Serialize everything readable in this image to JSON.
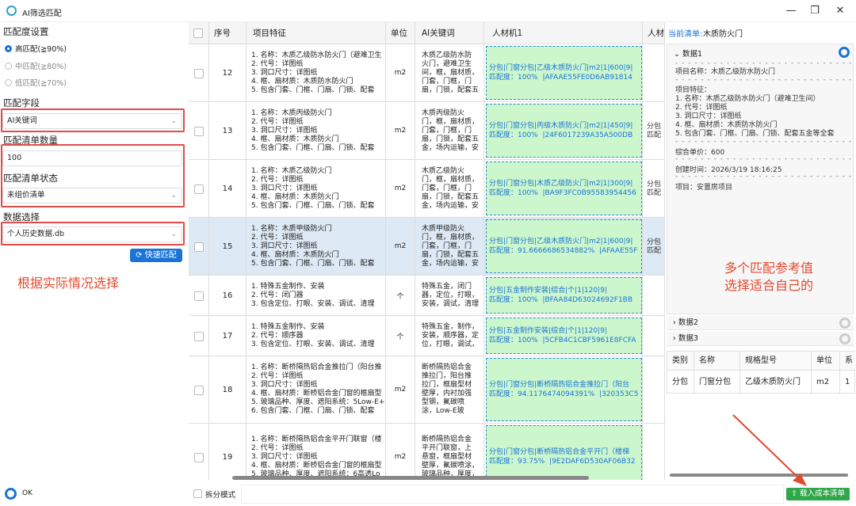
{
  "window": {
    "title": "AI筛选匹配",
    "min": "—",
    "max": "❐",
    "close": "✕"
  },
  "left": {
    "match_settings_label": "匹配度设置",
    "radios": [
      {
        "label": "高匹配(≧90%)",
        "selected": true
      },
      {
        "label": "中匹配(≧80%)",
        "selected": false
      },
      {
        "label": "低匹配(≧70%)",
        "selected": false
      }
    ],
    "match_field_label": "匹配字段",
    "match_field_value": "AI关键词",
    "list_count_label": "匹配清单数量",
    "list_count_value": "100",
    "list_status_label": "匹配清单状态",
    "list_status_value": "未组价清单",
    "data_select_label": "数据选择",
    "data_select_value": "个人历史数据.db",
    "quick_match_button": "快速匹配",
    "hint": "根据实际情况选择",
    "status_text": "OK"
  },
  "grid": {
    "headers": [
      "序号",
      "项目特征",
      "单位",
      "AI关键词",
      "人材机1",
      "人材"
    ],
    "rows": [
      {
        "no": "12",
        "spec": "1. 名称：木质乙级防水防火门（避难卫生\n2. 代号：详图纸\n3. 洞口尺寸：详图纸\n4. 框、扇材质：木质防水防火门\n5. 包含门套、门框、门扇、门锁、配套",
        "unit": "m2",
        "kw": "木质乙级防水防\n火门，避难卫生\n间，框，扇材质，\n门套，门框，门\n扇，门锁，配套五",
        "match": "分包|门窗分包|乙级木质防火门|m2|1|600|9|\n匹配度：100%  |AFAAE55FE0D6AB91814",
        "extra": ""
      },
      {
        "no": "13",
        "spec": "1. 名称：木质丙级防火门\n2. 代号：详图纸\n3. 洞口尺寸：详图纸\n4. 框、扇材质：木质防火门\n5. 包含门套、门框、门扇、门锁、配套",
        "unit": "m2",
        "kw": "木质丙级防火\n门，框，扇材质，\n门套，门框，门\n扇，门锁，配套五\n金，场内运输，安",
        "match": "分包|门窗分包|丙级木质防火门|m2|1|450|9|\n匹配度：100%  |24F6017239A35A500DB",
        "extra": "分包\n匹配"
      },
      {
        "no": "14",
        "spec": "1. 名称：木质乙级防火门\n2. 代号：详图纸\n3. 洞口尺寸：详图纸\n4. 框、扇材质：木质防火门\n5. 包含门套、门框、门扇、门锁、配套",
        "unit": "m2",
        "kw": "木质乙级防火\n门，框，扇材质，\n门套，门框，门\n扇，门锁，配套五\n金，场内运输，安",
        "match": "分包|门窗分包|木质乙级防火门|m2|1|300|9|\n匹配度：100%  |BA9F3FC0B95583954456",
        "extra": "分包\n匹配"
      },
      {
        "no": "15",
        "spec": "1. 名称：木质甲级防火门\n2. 代号：详图纸\n3. 洞口尺寸：详图纸\n4. 框、扇材质：木质防火门\n5. 包含门套、门框、门扇、门锁、配套",
        "unit": "m2",
        "kw": "木质甲级防火\n门，框，扇材质，\n门套，门框，门\n扇，门锁，配套五\n金，场内运输，安",
        "match": "分包|门窗分包|乙级木质防火门|m2|1|600|9|\n匹配度：91.6666686534882%  |AFAAE55F",
        "extra": "分包\n匹配"
      },
      {
        "no": "16",
        "spec": "1. 特殊五金制作、安装\n2. 代号：闭门器\n3. 包含定位、打眼、安装、调试、清理",
        "unit": "个",
        "kw": "特殊五金，闭门\n器，定位，打眼，\n安装，调试，清理",
        "match": "分包|五金制作安装|综合|个|1|120|9|\n匹配度：100%  |BFAA84D63024692F1BB",
        "extra": ""
      },
      {
        "no": "17",
        "spec": "1. 特殊五金制作、安装\n2. 代号：顺序器\n3. 包含定位、打眼、安装、调试、清理",
        "unit": "个",
        "kw": "特殊五金，制作，\n安装，顺序器，定\n位，打眼，调试，",
        "match": "分包|五金制作安装|综合|个|1|120|9|\n匹配度：100%  |5CFB4C1CBF5961E8FCFA",
        "extra": ""
      },
      {
        "no": "18",
        "spec": "1. 名称：断桥隔热铝合金推拉门（阳台推\n2. 代号：详图纸\n3. 洞口尺寸：详图纸\n4. 框、扇材质：断桥铝合金门窗的框扇型\n5. 玻璃品种、厚度、遮阳系统：5Low-E+\n6. 包含门套、门框、门扇、门锁、配套",
        "unit": "m2",
        "kw": "断桥隔热铝合金\n推拉门，阳台推\n拉门，框扇型材\n壁厚，内衬加强\n型钢，氟碳喷\n涂，Low-E玻",
        "match": "分包|门窗分包|断桥隔热铝合金推拉门（阳台\n匹配度：94.1176474094391%  |320353C5",
        "extra": ""
      },
      {
        "no": "19",
        "spec": "1. 名称：断桥隔热铝合金平开门联窗（楼\n2. 代号：详图纸\n3. 洞口尺寸：详图纸\n4. 框、扇材质：断桥铝合金门窗的框扇型\n5. 玻璃品种、厚度、遮阳系统：6高透Lo",
        "unit": "m2",
        "kw": "断桥隔热铝合金\n平开门联窗，上\n悬窗，框扇型材\n壁厚，氟碳喷涂，\n玻璃品种，厚度，",
        "match": "分包|门窗分包|断桥隔热铝合金平开门（楼梯\n匹配度：93.75%  |9E2DAF6D530AF06B32",
        "extra": ""
      }
    ]
  },
  "bottom": {
    "split_mode": "拆分模式",
    "load_button": "载入成本清单"
  },
  "right": {
    "current_label": "当前清单:",
    "current_value": "木质防火门",
    "panel1_title": "数据1",
    "dash": "- - - - - - - - - - - - - - - - - - - - - - - - - - - - - -",
    "item_name": "项目名称：木质乙级防水防火门",
    "feature_title": "项目特征：",
    "features": [
      "1. 名称：木质乙级防水防火门（避难卫生间）",
      "2. 代号：详图纸",
      "3. 洞口尺寸：详图纸",
      "4. 框、扇材质：木质防水防火门",
      "5. 包含门套、门框、门扇、门锁、配套五金等全套"
    ],
    "unit_price": "综合单价：600",
    "created": "创建时间：2026/3/19 18:16:25",
    "project": "项目：安置房项目",
    "hint_line1": "多个匹配参考值",
    "hint_line2": "选择适合自己的",
    "panel2_title": "数据2",
    "panel3_title": "数据3",
    "mini_headers": [
      "类别",
      "名称",
      "规格型号",
      "单位",
      "系"
    ],
    "mini_row": [
      "分包",
      "门窗分包",
      "乙级木质防火门",
      "m2",
      "1"
    ]
  }
}
